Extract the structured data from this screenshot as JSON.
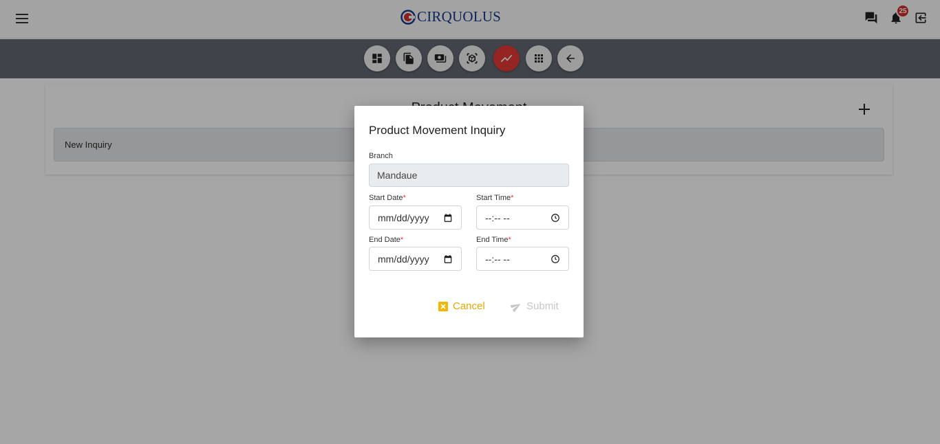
{
  "app": {
    "brand": "CIRQUOLUS"
  },
  "header": {
    "notification_count": "25"
  },
  "toolbar": {
    "icons": [
      "dashboard-icon",
      "documents-icon",
      "cash-icon",
      "inventory-scan-icon",
      "trending-icon",
      "apps-grid-icon",
      "back-arrow-icon"
    ],
    "active_index": 4
  },
  "page": {
    "title": "Product Movement",
    "row_label": "New Inquiry"
  },
  "modal": {
    "title": "Product Movement Inquiry",
    "branch_label": "Branch",
    "branch_value": "Mandaue",
    "start_date_label": "Start Date",
    "start_time_label": "Start Time",
    "end_date_label": "End Date",
    "end_time_label": "End Time",
    "required_mark": "*",
    "date_placeholder": "mm/dd/yyyy",
    "time_placeholder": "--:-- --",
    "cancel_label": "Cancel",
    "submit_label": "Submit"
  },
  "colors": {
    "accent_red": "#e53935",
    "cancel_yellow": "#e6a700",
    "toolbar_gray": "#646873"
  }
}
